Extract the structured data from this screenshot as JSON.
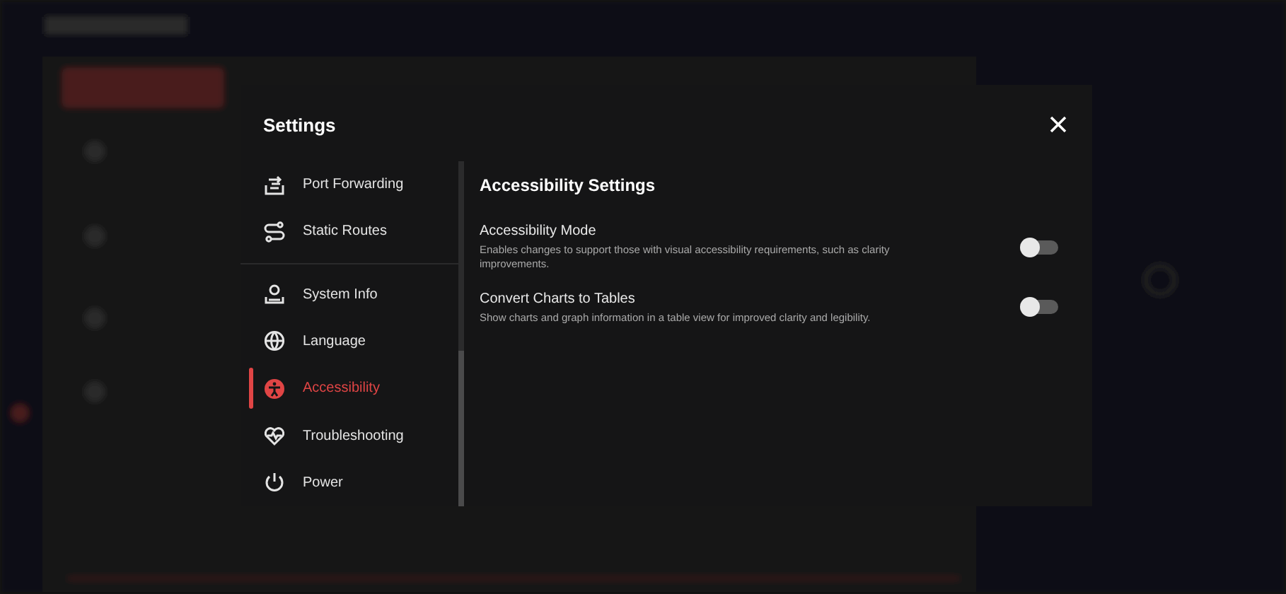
{
  "dialog": {
    "title": "Settings"
  },
  "nav": {
    "groups": [
      {
        "items": [
          {
            "label": "Port Forwarding",
            "kind": "port",
            "selected": false
          },
          {
            "label": "Static Routes",
            "kind": "routes",
            "selected": false
          }
        ]
      },
      {
        "items": [
          {
            "label": "System Info",
            "kind": "info",
            "selected": false
          },
          {
            "label": "Language",
            "kind": "globe",
            "selected": false
          },
          {
            "label": "Accessibility",
            "kind": "access",
            "selected": true
          },
          {
            "label": "Troubleshooting",
            "kind": "heart",
            "selected": false
          },
          {
            "label": "Power",
            "kind": "power",
            "selected": false
          }
        ]
      }
    ]
  },
  "content": {
    "title": "Accessibility Settings",
    "settings": [
      {
        "name": "Accessibility Mode",
        "description": "Enables changes to support those with visual accessibility requirements, such as clarity improvements.",
        "on": false
      },
      {
        "name": "Convert Charts to Tables",
        "description": "Show charts and graph information in a table view for improved clarity and legibility.",
        "on": false
      }
    ]
  }
}
